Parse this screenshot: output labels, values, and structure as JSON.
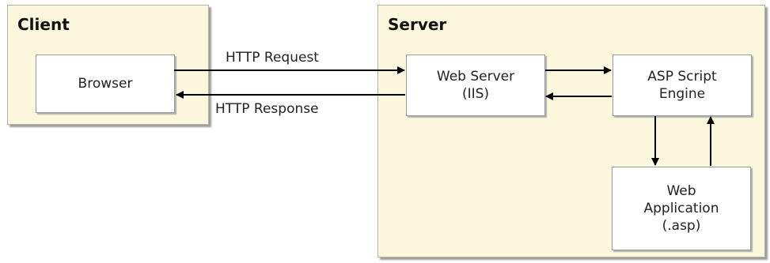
{
  "client": {
    "title": "Client",
    "browser": "Browser"
  },
  "server": {
    "title": "Server",
    "web_server": [
      "Web Server",
      "(IIS)"
    ],
    "asp_engine": [
      "ASP Script",
      "Engine"
    ],
    "web_app": [
      "Web",
      "Application",
      "(.asp)"
    ]
  },
  "edges": {
    "request": "HTTP Request",
    "response": "HTTP Response"
  },
  "colors": {
    "panel_fill": "#fbf7dc",
    "arrow": "#000000"
  }
}
